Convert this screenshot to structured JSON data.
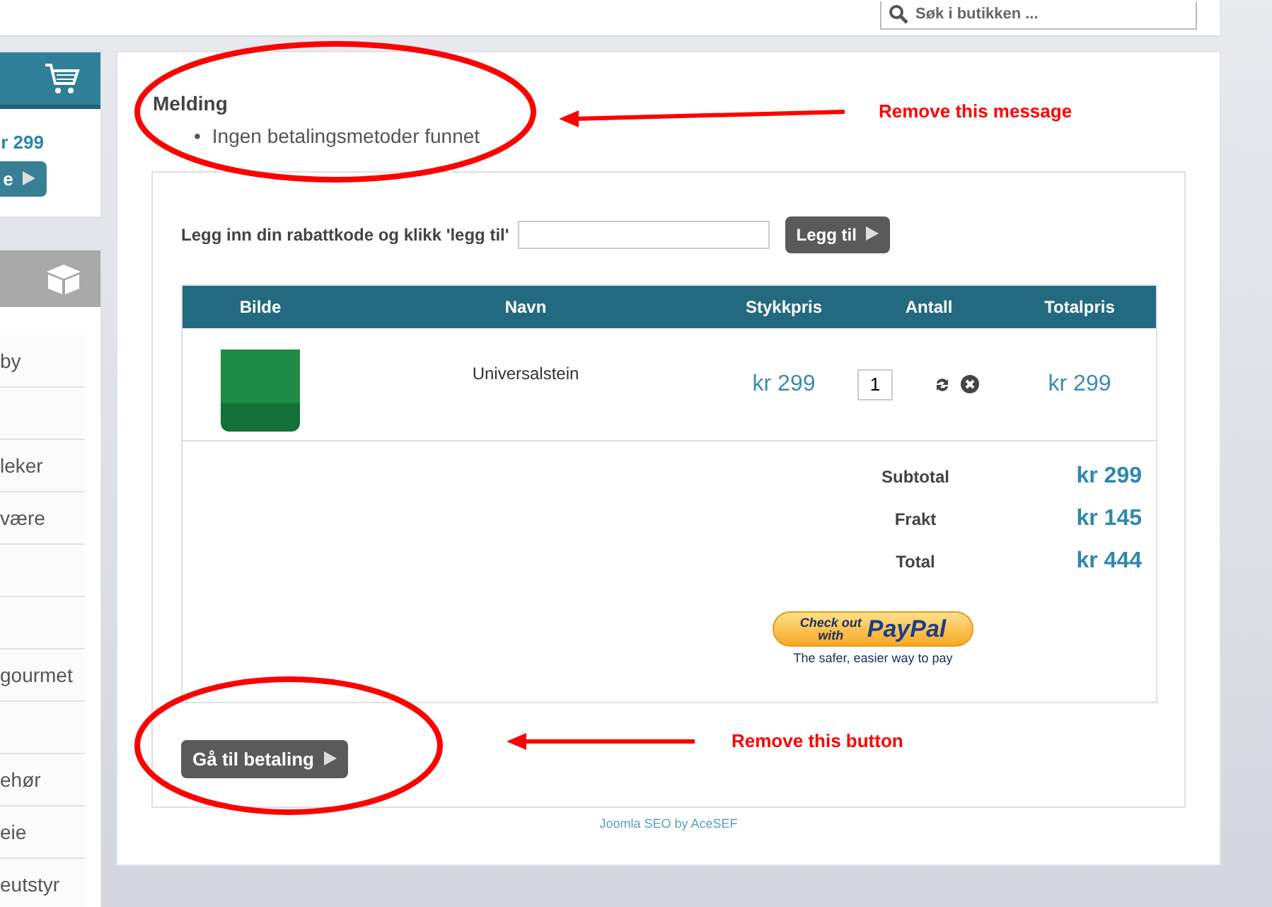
{
  "header": {
    "search": {
      "placeholder": "Søk i butikken ..."
    }
  },
  "sidebar": {
    "cart": {
      "total": "r 299",
      "button": "e"
    },
    "categories": [
      {
        "kind": "link",
        "label": "by"
      },
      {
        "kind": "blank"
      },
      {
        "kind": "link",
        "label": "leker"
      },
      {
        "kind": "link",
        "label": "være"
      },
      {
        "kind": "blank"
      },
      {
        "kind": "blank"
      },
      {
        "kind": "link",
        "label": "gourmet"
      },
      {
        "kind": "blank"
      },
      {
        "kind": "link",
        "label": "ehør"
      },
      {
        "kind": "link",
        "label": "eie"
      },
      {
        "kind": "link",
        "label": "eutstyr"
      }
    ]
  },
  "message": {
    "title": "Melding",
    "bullet": "•",
    "items": [
      "Ingen betalingsmetoder funnet"
    ]
  },
  "coupon": {
    "label": "Legg inn din rabattkode og klikk 'legg til'",
    "button": "Legg til"
  },
  "table": {
    "columns": [
      "Bilde",
      "Navn",
      "Stykkpris",
      "Antall",
      "Totalpris"
    ],
    "rows": [
      {
        "name": "Universalstein",
        "unit_price": "kr 299",
        "quantity": "1",
        "total": "kr 299"
      }
    ]
  },
  "totals": [
    {
      "label": "Subtotal",
      "value": "kr 299"
    },
    {
      "label": "Frakt",
      "value": "kr 145"
    },
    {
      "label": "Total",
      "value": "kr 444"
    }
  ],
  "paypal": {
    "check_out": "Check out",
    "with": "with",
    "brand": "PayPal",
    "tagline": "The safer, easier way to pay"
  },
  "checkout_button": "Gå til betaling",
  "footer_link": "Joomla SEO by AceSEF",
  "annotations": [
    "Remove this message",
    "Remove this button"
  ]
}
